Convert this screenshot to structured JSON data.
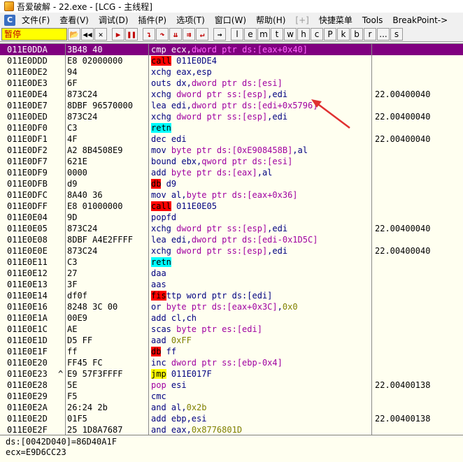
{
  "title": "吾爱破解 - 22.exe - [LCG - 主线程]",
  "menu": [
    "文件(F)",
    "查看(V)",
    "调试(D)",
    "插件(P)",
    "选项(T)",
    "窗口(W)",
    "帮助(H)",
    "[+]",
    "快捷菜单",
    "Tools",
    "BreakPoint->"
  ],
  "menu_icon": "C",
  "status": "暂停",
  "toolbar_letters": [
    "l",
    "e",
    "m",
    "t",
    "w",
    "h",
    "c",
    "P",
    "k",
    "b",
    "r",
    "...",
    "s"
  ],
  "rows": [
    {
      "addr": "011E0DDA",
      "mark": "",
      "hex": "3B48 40",
      "comment": "",
      "selected": true,
      "asm": [
        [
          "cmp ",
          "c-sel"
        ],
        [
          "ecx",
          "c-sel"
        ],
        [
          ",",
          "c-sel"
        ],
        [
          "dword ptr ds:[eax+0x40]",
          "c-selop"
        ]
      ]
    },
    {
      "addr": "011E0DDD",
      "mark": "",
      "hex": "E8 02000000",
      "comment": "",
      "asm": [
        [
          "call",
          "c-call"
        ],
        [
          " 011E0DE4",
          "c-mn"
        ]
      ]
    },
    {
      "addr": "011E0DE2",
      "mark": "",
      "hex": "94",
      "comment": "",
      "asm": [
        [
          "xchg ",
          "c-mn"
        ],
        [
          "eax,esp",
          "c-mn"
        ]
      ]
    },
    {
      "addr": "011E0DE3",
      "mark": "",
      "hex": "6F",
      "comment": "",
      "asm": [
        [
          "outs ",
          "c-mn"
        ],
        [
          "dx,",
          "c-mn"
        ],
        [
          "dword ptr ds:[esi]",
          "c-kw"
        ]
      ]
    },
    {
      "addr": "011E0DE4",
      "mark": "",
      "hex": "873C24",
      "comment": "22.00400040",
      "asm": [
        [
          "xchg ",
          "c-mn"
        ],
        [
          "dword ptr ss:[esp]",
          "c-kw"
        ],
        [
          ",edi",
          "c-mn"
        ]
      ]
    },
    {
      "addr": "011E0DE7",
      "mark": "",
      "hex": "8DBF 96570000",
      "comment": "",
      "asm": [
        [
          "lea ",
          "c-mn"
        ],
        [
          "edi,",
          "c-mn"
        ],
        [
          "dword ptr ds:[edi+0x5796]",
          "c-kw"
        ]
      ]
    },
    {
      "addr": "011E0DED",
      "mark": "",
      "hex": "873C24",
      "comment": "22.00400040",
      "asm": [
        [
          "xchg ",
          "c-mn"
        ],
        [
          "dword ptr ss:[esp]",
          "c-kw"
        ],
        [
          ",edi",
          "c-mn"
        ]
      ]
    },
    {
      "addr": "011E0DF0",
      "mark": "",
      "hex": "C3",
      "comment": "",
      "asm": [
        [
          "retn",
          "c-ret"
        ]
      ]
    },
    {
      "addr": "011E0DF1",
      "mark": "",
      "hex": "4F",
      "comment": "22.00400040",
      "asm": [
        [
          "dec ",
          "c-mn"
        ],
        [
          "edi",
          "c-mn"
        ]
      ]
    },
    {
      "addr": "011E0DF2",
      "mark": "",
      "hex": "A2 8B4508E9",
      "comment": "",
      "asm": [
        [
          "mov ",
          "c-mn"
        ],
        [
          "byte ptr ds:[0xE908458B]",
          "c-kw"
        ],
        [
          ",al",
          "c-mn"
        ]
      ]
    },
    {
      "addr": "011E0DF7",
      "mark": "",
      "hex": "621E",
      "comment": "",
      "asm": [
        [
          "bound ",
          "c-mn"
        ],
        [
          "ebx,",
          "c-mn"
        ],
        [
          "qword ptr ds:[esi]",
          "c-kw"
        ]
      ]
    },
    {
      "addr": "011E0DF9",
      "mark": "",
      "hex": "0000",
      "comment": "",
      "asm": [
        [
          "add ",
          "c-mn"
        ],
        [
          "byte ptr ds:[eax]",
          "c-kw"
        ],
        [
          ",al",
          "c-mn"
        ]
      ]
    },
    {
      "addr": "011E0DFB",
      "mark": "",
      "hex": "d9",
      "comment": "",
      "asm": [
        [
          "db",
          "c-db"
        ],
        [
          " d9",
          "c-mn"
        ]
      ]
    },
    {
      "addr": "011E0DFC",
      "mark": "",
      "hex": "8A40 36",
      "comment": "",
      "asm": [
        [
          "mov ",
          "c-mn"
        ],
        [
          "al,",
          "c-mn"
        ],
        [
          "byte ptr ds:[eax+0x36]",
          "c-kw"
        ]
      ]
    },
    {
      "addr": "011E0DFF",
      "mark": "",
      "hex": "E8 01000000",
      "comment": "",
      "asm": [
        [
          "call",
          "c-call"
        ],
        [
          " 011E0E05",
          "c-mn"
        ]
      ]
    },
    {
      "addr": "011E0E04",
      "mark": "",
      "hex": "9D",
      "comment": "",
      "asm": [
        [
          "popfd",
          "c-mn"
        ]
      ]
    },
    {
      "addr": "011E0E05",
      "mark": "",
      "hex": "873C24",
      "comment": "22.00400040",
      "asm": [
        [
          "xchg ",
          "c-mn"
        ],
        [
          "dword ptr ss:[esp]",
          "c-kw"
        ],
        [
          ",edi",
          "c-mn"
        ]
      ]
    },
    {
      "addr": "011E0E08",
      "mark": "",
      "hex": "8DBF A4E2FFFF",
      "comment": "",
      "asm": [
        [
          "lea ",
          "c-mn"
        ],
        [
          "edi,",
          "c-mn"
        ],
        [
          "dword ptr ds:[edi-0x1D5C]",
          "c-kw"
        ]
      ]
    },
    {
      "addr": "011E0E0E",
      "mark": "",
      "hex": "873C24",
      "comment": "22.00400040",
      "asm": [
        [
          "xchg ",
          "c-mn"
        ],
        [
          "dword ptr ss:[esp]",
          "c-kw"
        ],
        [
          ",edi",
          "c-mn"
        ]
      ]
    },
    {
      "addr": "011E0E11",
      "mark": "",
      "hex": "C3",
      "comment": "",
      "asm": [
        [
          "retn",
          "c-ret"
        ]
      ]
    },
    {
      "addr": "011E0E12",
      "mark": "",
      "hex": "27",
      "comment": "",
      "asm": [
        [
          "daa",
          "c-mn"
        ]
      ]
    },
    {
      "addr": "011E0E13",
      "mark": "",
      "hex": "3F",
      "comment": "",
      "asm": [
        [
          "aas",
          "c-mn"
        ]
      ]
    },
    {
      "addr": "011E0E14",
      "mark": "",
      "hex": "df0f",
      "comment": "",
      "asm": [
        [
          "fis",
          "c-db"
        ],
        [
          "ttp word ptr ds:[edi]",
          "c-mn"
        ]
      ]
    },
    {
      "addr": "011E0E16",
      "mark": "",
      "hex": "8248 3C 00",
      "comment": "",
      "asm": [
        [
          "or ",
          "c-mn"
        ],
        [
          "byte ptr ds:[eax+0x3C]",
          "c-kw"
        ],
        [
          ",",
          "c-mn"
        ],
        [
          "0x0",
          "c-num"
        ]
      ]
    },
    {
      "addr": "011E0E1A",
      "mark": "",
      "hex": "00E9",
      "comment": "",
      "asm": [
        [
          "add ",
          "c-mn"
        ],
        [
          "cl,ch",
          "c-mn"
        ]
      ]
    },
    {
      "addr": "011E0E1C",
      "mark": "",
      "hex": "AE",
      "comment": "",
      "asm": [
        [
          "scas ",
          "c-mn"
        ],
        [
          "byte ptr es:[edi]",
          "c-kw"
        ]
      ]
    },
    {
      "addr": "011E0E1D",
      "mark": "",
      "hex": "D5 FF",
      "comment": "",
      "asm": [
        [
          "aad ",
          "c-mn"
        ],
        [
          "0xFF",
          "c-num"
        ]
      ]
    },
    {
      "addr": "011E0E1F",
      "mark": "",
      "hex": "ff",
      "comment": "",
      "asm": [
        [
          "db",
          "c-db"
        ],
        [
          " ff",
          "c-mn"
        ]
      ]
    },
    {
      "addr": "011E0E20",
      "mark": "",
      "hex": "FF45 FC",
      "comment": "",
      "asm": [
        [
          "inc ",
          "c-mn"
        ],
        [
          "dword ptr ss:[ebp-0x4]",
          "c-kw"
        ]
      ]
    },
    {
      "addr": "011E0E23",
      "mark": "^",
      "hex": "E9 57F3FFFF",
      "comment": "",
      "asm": [
        [
          "jmp",
          "c-jmp"
        ],
        [
          " 011E017F",
          "c-mn"
        ]
      ]
    },
    {
      "addr": "011E0E28",
      "mark": "",
      "hex": "5E",
      "comment": "22.00400138",
      "asm": [
        [
          "pop ",
          "c-kw"
        ],
        [
          "esi",
          "c-mn"
        ]
      ]
    },
    {
      "addr": "011E0E29",
      "mark": "",
      "hex": "F5",
      "comment": "",
      "asm": [
        [
          "cmc",
          "c-mn"
        ]
      ]
    },
    {
      "addr": "011E0E2A",
      "mark": "",
      "hex": "26:24 2b",
      "comment": "",
      "asm": [
        [
          "and ",
          "c-mn"
        ],
        [
          "al,",
          "c-mn"
        ],
        [
          "0x2b",
          "c-num"
        ]
      ]
    },
    {
      "addr": "011E0E2D",
      "mark": "",
      "hex": "01F5",
      "comment": "22.00400138",
      "asm": [
        [
          "add ",
          "c-mn"
        ],
        [
          "ebp,esi",
          "c-mn"
        ]
      ]
    },
    {
      "addr": "011E0E2F",
      "mark": "",
      "hex": "25 1D8A7687",
      "comment": "",
      "asm": [
        [
          "and ",
          "c-mn"
        ],
        [
          "eax,",
          "c-mn"
        ],
        [
          "0x8776801D",
          "c-num"
        ]
      ]
    }
  ],
  "info_lines": [
    "ds:[0042D040]=86D40A1F",
    "ecx=E9D6CC23"
  ],
  "colors": {
    "selected_row": "#800080",
    "panel_bg": "#fffff0",
    "status_bg": "#ffff00",
    "arrow": "#e03030"
  }
}
